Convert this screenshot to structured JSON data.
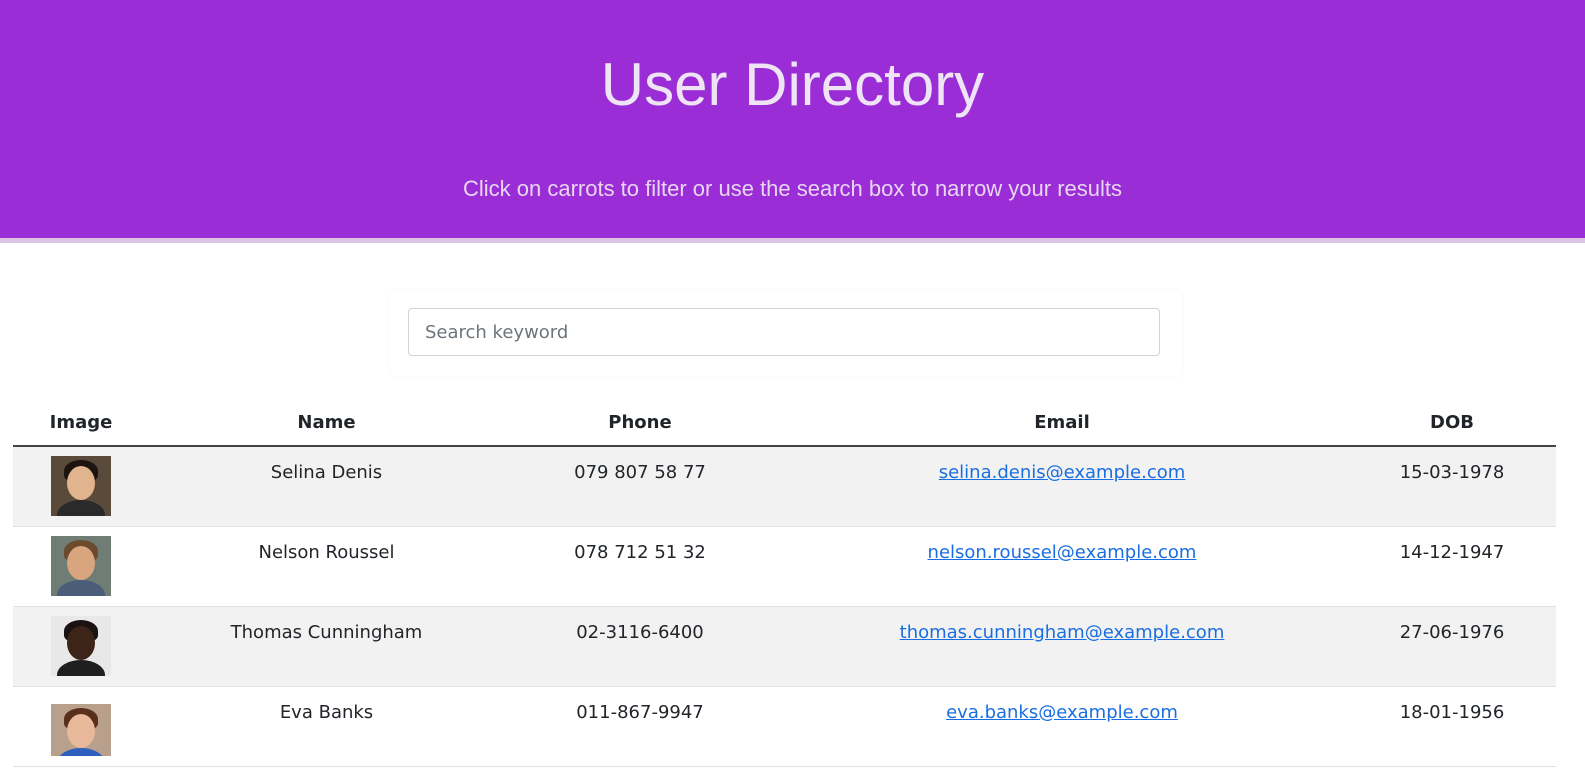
{
  "header": {
    "title": "User Directory",
    "subtitle": "Click on carrots to filter or use the search box to narrow your results",
    "background_color": "#9b2dd6"
  },
  "search": {
    "placeholder": "Search keyword",
    "value": ""
  },
  "table": {
    "columns": [
      "Image",
      "Name",
      "Phone",
      "Email",
      "DOB"
    ],
    "rows": [
      {
        "image": "avatar-woman-dark-hair",
        "name": "Selina Denis",
        "phone": "079 807 58 77",
        "email": "selina.denis@example.com",
        "dob": "15-03-1978"
      },
      {
        "image": "avatar-man-beard",
        "name": "Nelson Roussel",
        "phone": "078 712 51 32",
        "email": "nelson.roussel@example.com",
        "dob": "14-12-1947"
      },
      {
        "image": "avatar-man-glasses",
        "name": "Thomas Cunningham",
        "phone": "02-3116-6400",
        "email": "thomas.cunningham@example.com",
        "dob": "27-06-1976"
      },
      {
        "image": "avatar-woman-blue-top",
        "name": "Eva Banks",
        "phone": "011-867-9947",
        "email": "eva.banks@example.com",
        "dob": "18-01-1956"
      }
    ]
  },
  "colors": {
    "link": "#1a6ee0",
    "row_stripe": "#f2f2f2"
  }
}
